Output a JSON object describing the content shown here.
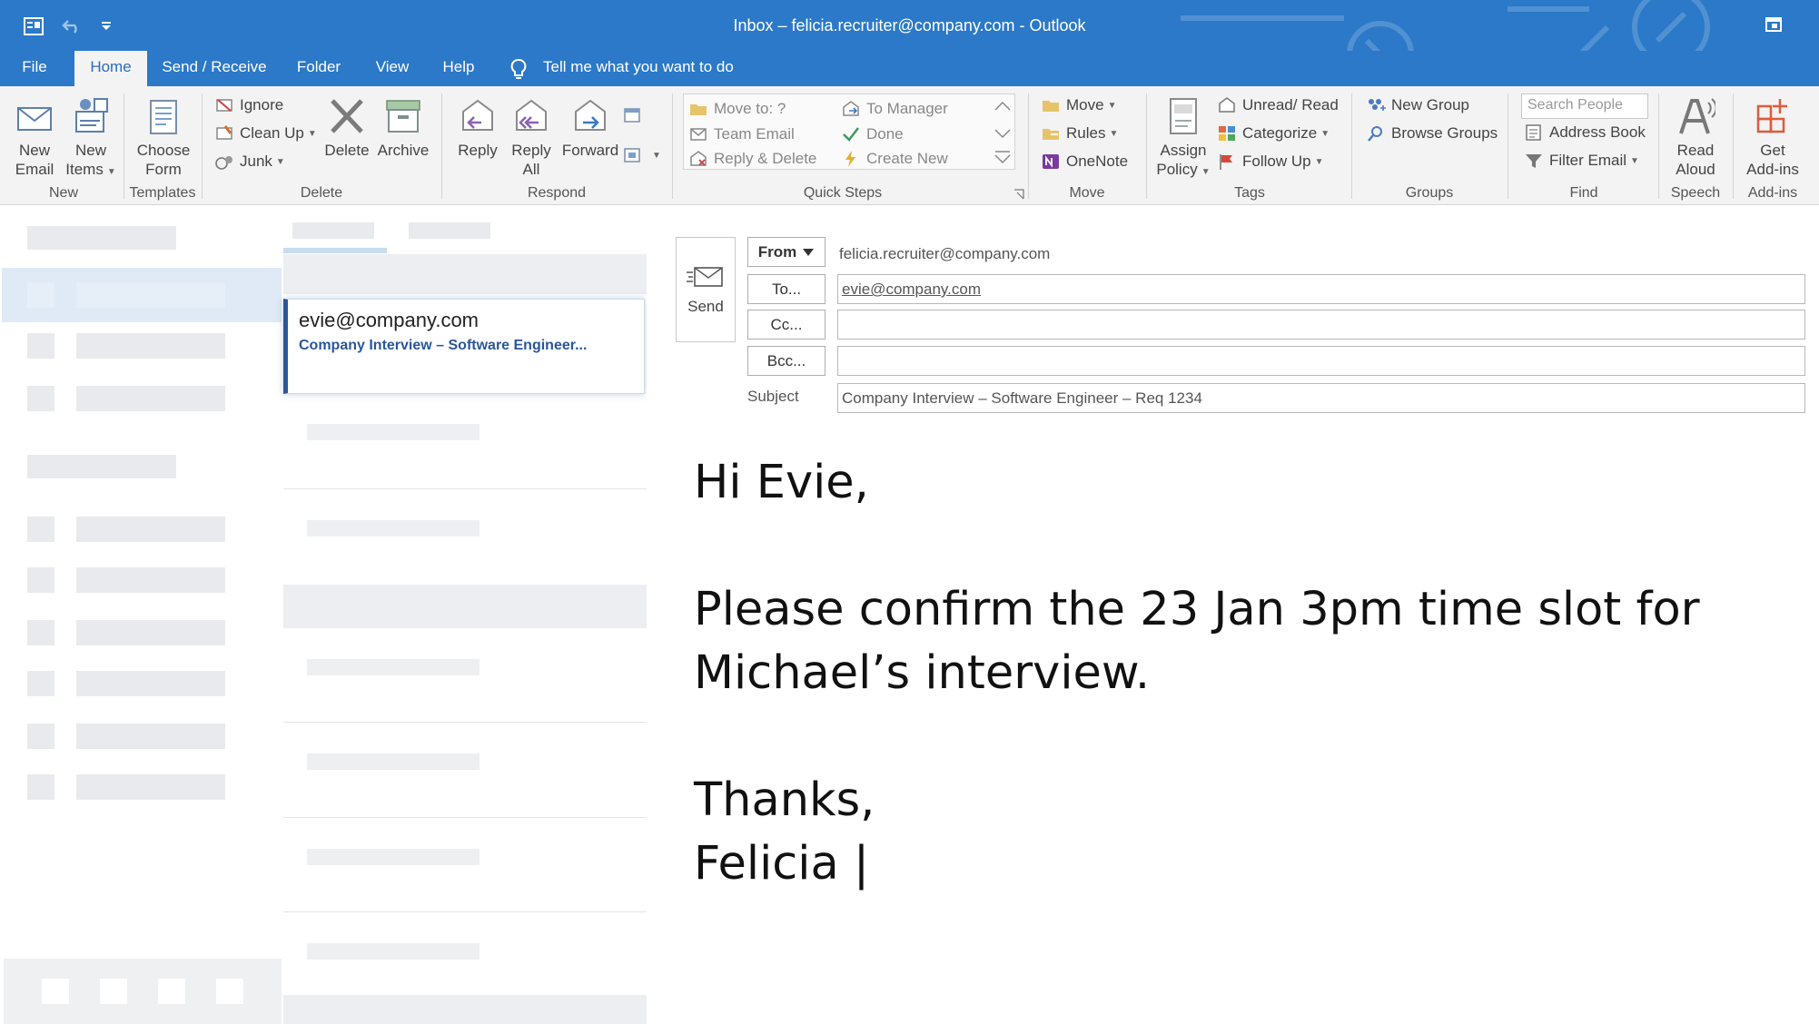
{
  "window": {
    "title": "Inbox  –  felicia.recruiter@company.com  -  Outlook",
    "qat_icons": [
      "outlook-icon",
      "undo-icon",
      "customize-qat-icon"
    ],
    "restore_icon": "restore-window-icon"
  },
  "menu": {
    "tabs": [
      "File",
      "Home",
      "Send / Receive",
      "Folder",
      "View",
      "Help"
    ],
    "active_tab": "Home",
    "tell_me": "Tell me what you want to do"
  },
  "ribbon": {
    "groups": {
      "new": "New",
      "templates": "Templates",
      "delete": "Delete",
      "respond": "Respond",
      "quick_steps": "Quick Steps",
      "move": "Move",
      "tags": "Tags",
      "groups": "Groups",
      "find": "Find",
      "speech": "Speech",
      "addins": "Add-ins"
    },
    "new_email": [
      "New",
      "Email"
    ],
    "new_items": [
      "New",
      "Items"
    ],
    "choose_form": [
      "Choose",
      "Form"
    ],
    "ignore": "Ignore",
    "clean_up": "Clean Up",
    "junk": "Junk",
    "delete": "Delete",
    "archive": "Archive",
    "reply": "Reply",
    "reply_all": [
      "Reply",
      "All"
    ],
    "forward": "Forward",
    "quick_steps": {
      "move_to": "Move to: ?",
      "team_email": "Team Email",
      "reply_delete": "Reply & Delete",
      "to_manager": "To Manager",
      "done": "Done",
      "create_new": "Create New"
    },
    "move": "Move",
    "rules": "Rules",
    "onenote": "OneNote",
    "assign_policy": [
      "Assign",
      "Policy"
    ],
    "unread_read": "Unread/ Read",
    "categorize": "Categorize",
    "follow_up": "Follow Up",
    "new_group": "New Group",
    "browse_groups": "Browse Groups",
    "search_people": "Search People",
    "address_book": "Address Book",
    "filter_email": "Filter Email",
    "read_aloud": [
      "Read",
      "Aloud"
    ],
    "get_addins": [
      "Get",
      "Add-ins"
    ]
  },
  "message_list": {
    "selected": {
      "sender": "evie@company.com",
      "subject": "Company Interview – Software Engineer..."
    }
  },
  "compose": {
    "send": "Send",
    "from_label": "From",
    "from_value": "felicia.recruiter@company.com",
    "to_label": "To...",
    "to_value": "evie@company.com",
    "cc_label": "Cc...",
    "cc_value": "",
    "bcc_label": "Bcc...",
    "bcc_value": "",
    "subject_label": "Subject",
    "subject_value": "Company Interview – Software Engineer – Req 1234",
    "body": {
      "greeting": "Hi Evie,",
      "line1": "Please confirm the 23 Jan 3pm time slot for",
      "line2": "Michael’s interview.",
      "closing": "Thanks,",
      "signature": "Felicia |"
    }
  },
  "colors": {
    "titlebar": "#2b79c8",
    "ribbon": "#f3f3f3",
    "accent": "#2b579a",
    "selected_folder": "#dfeaf6"
  }
}
